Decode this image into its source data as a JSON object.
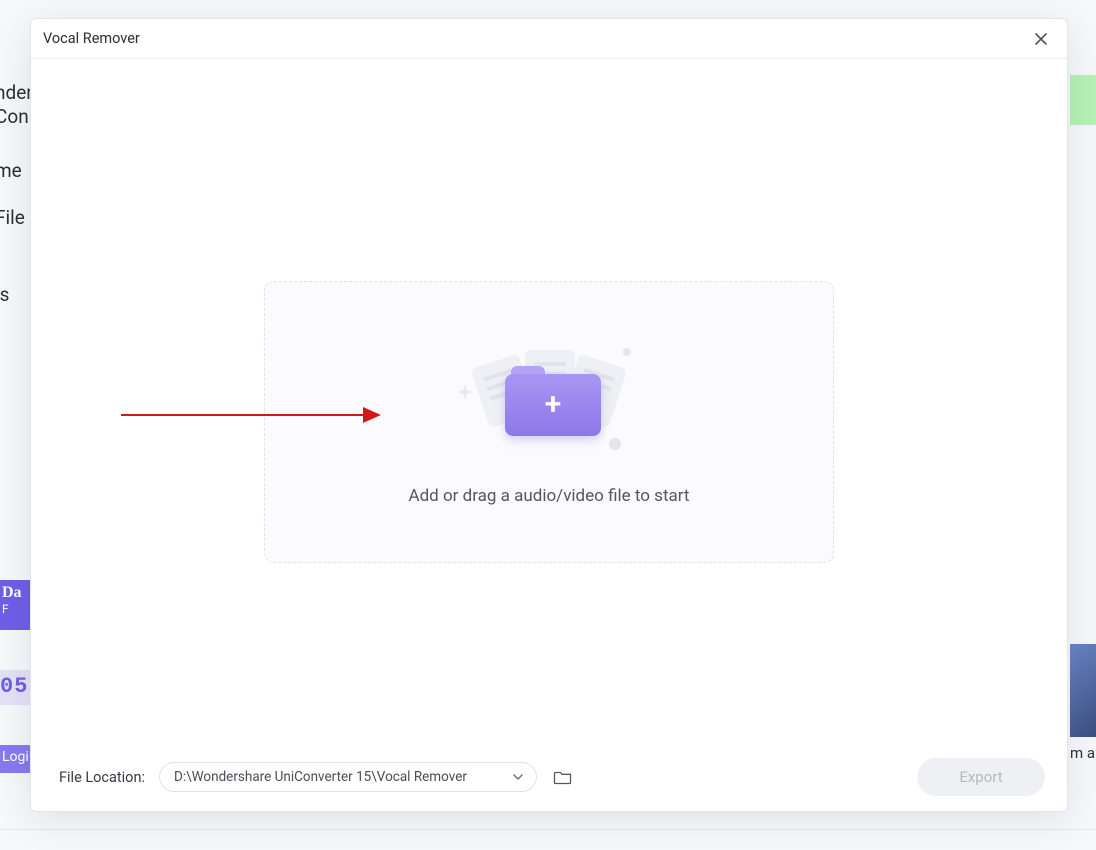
{
  "background": {
    "frag_nder": "nder",
    "frag_con": "Con",
    "frag_me": "me",
    "frag_file": "File",
    "frag_ls": "ls",
    "da_line1": "Da",
    "da_line2": "F",
    "num05": "05",
    "login": "Logi",
    "right_text": "m a"
  },
  "modal": {
    "title": "Vocal Remover",
    "dropzone_text": "Add or drag a audio/video file to start"
  },
  "footer": {
    "location_label": "File Location:",
    "location_path": "D:\\Wondershare UniConverter 15\\Vocal Remover",
    "export_label": "Export"
  }
}
